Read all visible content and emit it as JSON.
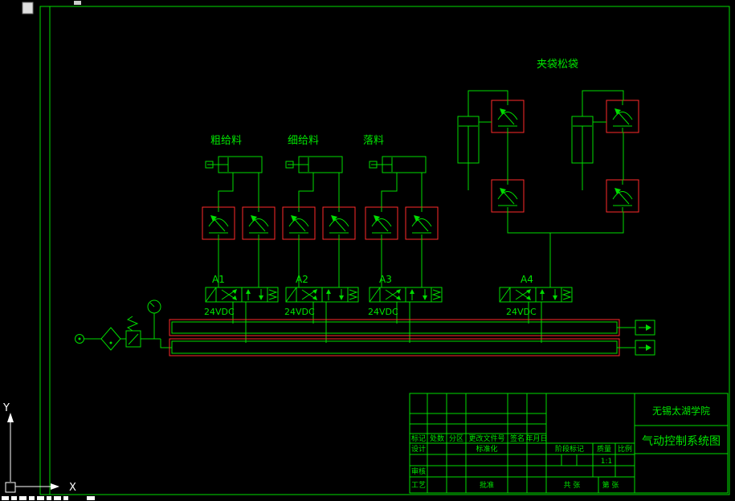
{
  "colors": {
    "background": "#000000",
    "line_green": "#00dc00",
    "highlight_red": "#ff2a2a",
    "axis_white": "#ffffff"
  },
  "schematic": {
    "actuators": [
      {
        "label": "粗给料",
        "valve_tag": "A1",
        "voltage": "24VDC"
      },
      {
        "label": "细给料",
        "valve_tag": "A2",
        "voltage": "24VDC"
      },
      {
        "label": "落料",
        "valve_tag": "A3",
        "voltage": "24VDC"
      },
      {
        "label": "夹袋松袋",
        "valve_tag": "A4",
        "voltage": "24VDC"
      }
    ]
  },
  "axis": {
    "x": "X",
    "y": "Y"
  },
  "title_block": {
    "school": "无锡太湖学院",
    "drawing_title": "气动控制系统图",
    "headers": {
      "mark": "标记",
      "count": "处数",
      "zone": "分区",
      "change_file_no": "更改文件号",
      "signature": "签名",
      "date": "年月日"
    },
    "roles": {
      "design": "设计",
      "standardization": "标准化",
      "check": "审核",
      "process": "工艺",
      "approve": "批准"
    },
    "stage": {
      "stage_mark": "阶段标记",
      "weight": "质量",
      "scale": "比例",
      "scale_value": "1:1"
    },
    "sheets": {
      "total": "共 张",
      "number": "第 张"
    }
  }
}
